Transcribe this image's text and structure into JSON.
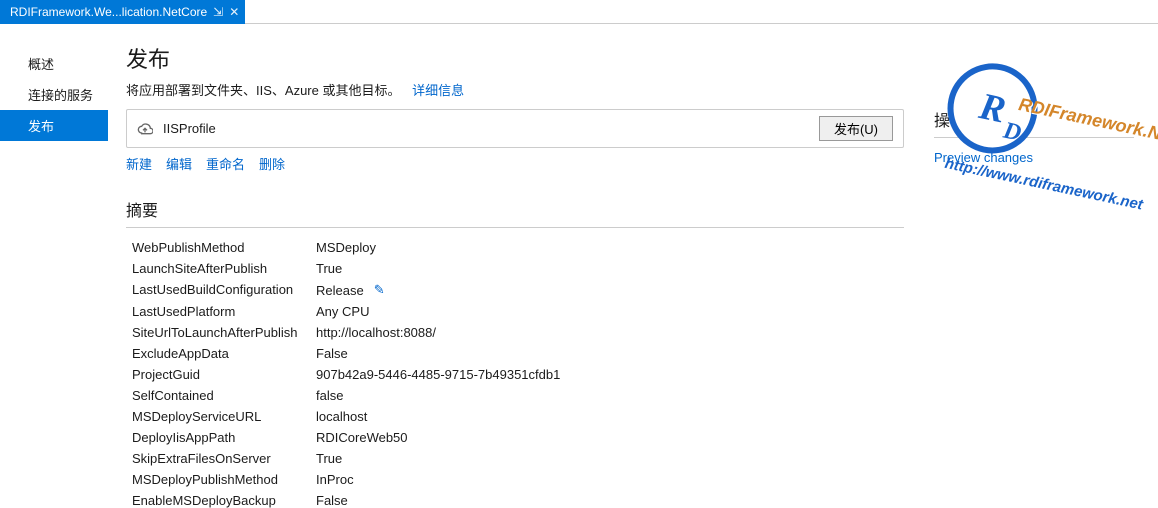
{
  "tab": {
    "title": "RDIFramework.We...lication.NetCore"
  },
  "sidebar": {
    "items": [
      {
        "label": "概述"
      },
      {
        "label": "连接的服务"
      },
      {
        "label": "发布"
      }
    ],
    "active": 2
  },
  "page": {
    "title": "发布",
    "subtitle": "将应用部署到文件夹、IIS、Azure 或其他目标。",
    "learnMore": "详细信息"
  },
  "profile": {
    "name": "IISProfile",
    "publishBtn": "发布(U)"
  },
  "profileLinks": {
    "new": "新建",
    "edit": "编辑",
    "rename": "重命名",
    "del": "删除"
  },
  "summary": {
    "heading": "摘要",
    "rows": [
      {
        "k": "WebPublishMethod",
        "v": "MSDeploy"
      },
      {
        "k": "LaunchSiteAfterPublish",
        "v": "True"
      },
      {
        "k": "LastUsedBuildConfiguration",
        "v": "Release",
        "editable": true
      },
      {
        "k": "LastUsedPlatform",
        "v": "Any CPU"
      },
      {
        "k": "SiteUrlToLaunchAfterPublish",
        "v": "http://localhost:8088/"
      },
      {
        "k": "ExcludeAppData",
        "v": "False"
      },
      {
        "k": "ProjectGuid",
        "v": "907b42a9-5446-4485-9715-7b49351cfdb1"
      },
      {
        "k": "SelfContained",
        "v": "false"
      },
      {
        "k": "MSDeployServiceURL",
        "v": "localhost"
      },
      {
        "k": "DeployIisAppPath",
        "v": "RDICoreWeb50"
      },
      {
        "k": "SkipExtraFilesOnServer",
        "v": "True"
      },
      {
        "k": "MSDeployPublishMethod",
        "v": "InProc"
      },
      {
        "k": "EnableMSDeployBackup",
        "v": "False"
      }
    ]
  },
  "actions": {
    "heading": "操作",
    "preview": "Preview changes"
  },
  "watermark": {
    "brand": "RDIFramework.NET",
    "url": "http://www.rdiframework.net"
  }
}
